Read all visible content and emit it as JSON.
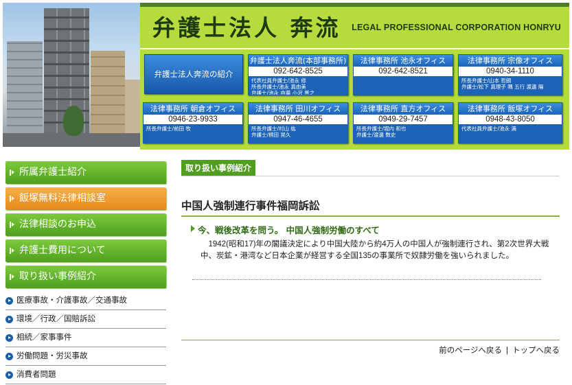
{
  "header": {
    "title": "弁護士法人 奔流",
    "subtitle": "LEGAL PROFESSIONAL CORPORATION HONRYU",
    "intro_label": "弁護士法人奔流の紹介"
  },
  "offices": [
    {
      "name": "弁護士法人奔流(本部事務所)",
      "tel": "092-642-8525",
      "staff": "代表社員弁護士/池永 修\n所長弁護士/池永 真由美\n弁護士/池永 由華 小沢 晋之"
    },
    {
      "name": "法律事務所 池永オフィス",
      "tel": "092-642-8521",
      "staff": ""
    },
    {
      "name": "法律事務所 宗像オフィス",
      "tel": "0940-34-1110",
      "staff": "所長弁護士/山本 哲朗\n弁護士/松下 真理子 隅 五行 渡邊 陽"
    },
    {
      "name": "法律事務所 朝倉オフィス",
      "tel": "0946-23-9933",
      "staff": "所長弁護士/前田 牧"
    },
    {
      "name": "法律事務所 田川オフィス",
      "tel": "0947-46-4655",
      "staff": "所長弁護士/村山 紘\n弁護士/柄田 晃久"
    },
    {
      "name": "法律事務所 直方オフィス",
      "tel": "0949-29-7457",
      "staff": "所長弁護士/堀内 和也\n弁護士/渡邊 数史"
    },
    {
      "name": "法律事務所 飯塚オフィス",
      "tel": "0948-43-8050",
      "staff": "代表社員弁護士/池永 満"
    }
  ],
  "sidebar": {
    "nav": [
      {
        "label": "所属弁護士紹介",
        "style": "green"
      },
      {
        "label": "飯塚無料法律相談室",
        "style": "orange"
      },
      {
        "label": "法律相談のお申込",
        "style": "green"
      },
      {
        "label": "弁護士費用について",
        "style": "green"
      },
      {
        "label": "取り扱い事例紹介",
        "style": "green"
      }
    ],
    "sub": [
      "医療事故・介護事故／交通事故",
      "環境／行政／国賠訴訟",
      "相続／家事事件",
      "労働問題・労災事故",
      "消費者問題"
    ]
  },
  "main": {
    "section_tag": "取り扱い事例紹介",
    "page_title": "中国人強制連行事件福岡訴訟",
    "article_head": "今、戦後改革を問う。 中国人強制労働のすべて",
    "article_body": "1942(昭和17)年の閣議決定により中国大陸から約4万人の中国人が強制連行され、第2次世界大戦中、炭鉱・港湾など日本企業が経営する全国135の事業所で奴隷労働を強いられました。",
    "prev_link": "前のページへ戻る",
    "sep": "|",
    "top_link": "トップへ戻る"
  }
}
